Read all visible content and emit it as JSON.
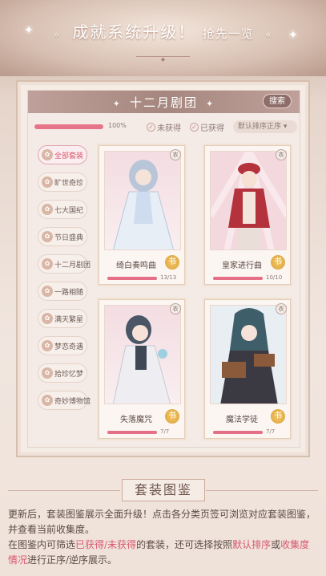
{
  "headline": {
    "main": "成就系统升级！",
    "sub": "抢先一览",
    "chev_left": "»",
    "chev_right": "«"
  },
  "panel": {
    "title": "十二月剧团",
    "search_label": "搜索",
    "progress": {
      "percent": 100,
      "label": "100%"
    },
    "filters": {
      "unobtained": "未获得",
      "obtained": "已获得"
    },
    "sort": {
      "label": "默认排序正序",
      "caret": "▾"
    }
  },
  "sidebar": {
    "items": [
      {
        "label": "全部套装",
        "icon": "set-icon",
        "active": true
      },
      {
        "label": "旷世奇珍",
        "icon": "treasure-icon"
      },
      {
        "label": "七大国纪",
        "icon": "globe-icon"
      },
      {
        "label": "节日盛典",
        "icon": "festival-icon"
      },
      {
        "label": "十二月剧团",
        "icon": "theater-icon"
      },
      {
        "label": "一路相随",
        "icon": "heart-icon"
      },
      {
        "label": "满天繁星",
        "icon": "star-icon"
      },
      {
        "label": "梦恋奇遇",
        "icon": "dream-icon"
      },
      {
        "label": "拾珍忆梦",
        "icon": "shell-icon"
      },
      {
        "label": "奇妙博物馆",
        "icon": "museum-icon"
      }
    ]
  },
  "cards": [
    {
      "name": "绮白奏鸣曲",
      "count": "13/13",
      "fraction": 1.0,
      "badge": "书",
      "corner": "衣"
    },
    {
      "name": "皇家进行曲",
      "count": "10/10",
      "fraction": 1.0,
      "badge": "书",
      "corner": "衣"
    },
    {
      "name": "失落魔咒",
      "count": "7/7",
      "fraction": 1.0,
      "badge": "书",
      "corner": "衣"
    },
    {
      "name": "魔法学徒",
      "count": "7/7",
      "fraction": 1.0,
      "badge": "书",
      "corner": "衣"
    }
  ],
  "section": {
    "title": "套装图鉴",
    "line1": "更新后，套装图鉴展示全面升级！点击各分类页签可浏览对应套装图鉴，并查看当前收集度。",
    "line2_a": "在图鉴内可筛选",
    "line2_b": "已获得/未获得",
    "line2_c": "的套装，还可选择按照",
    "line2_d": "默认排序",
    "line2_e": "或",
    "line2_f": "收集度情况",
    "line2_g": "进行正序/逆序展示。"
  },
  "colors": {
    "accent": "#d8576e",
    "header": "#a5877f",
    "badge": "#d9a138"
  }
}
